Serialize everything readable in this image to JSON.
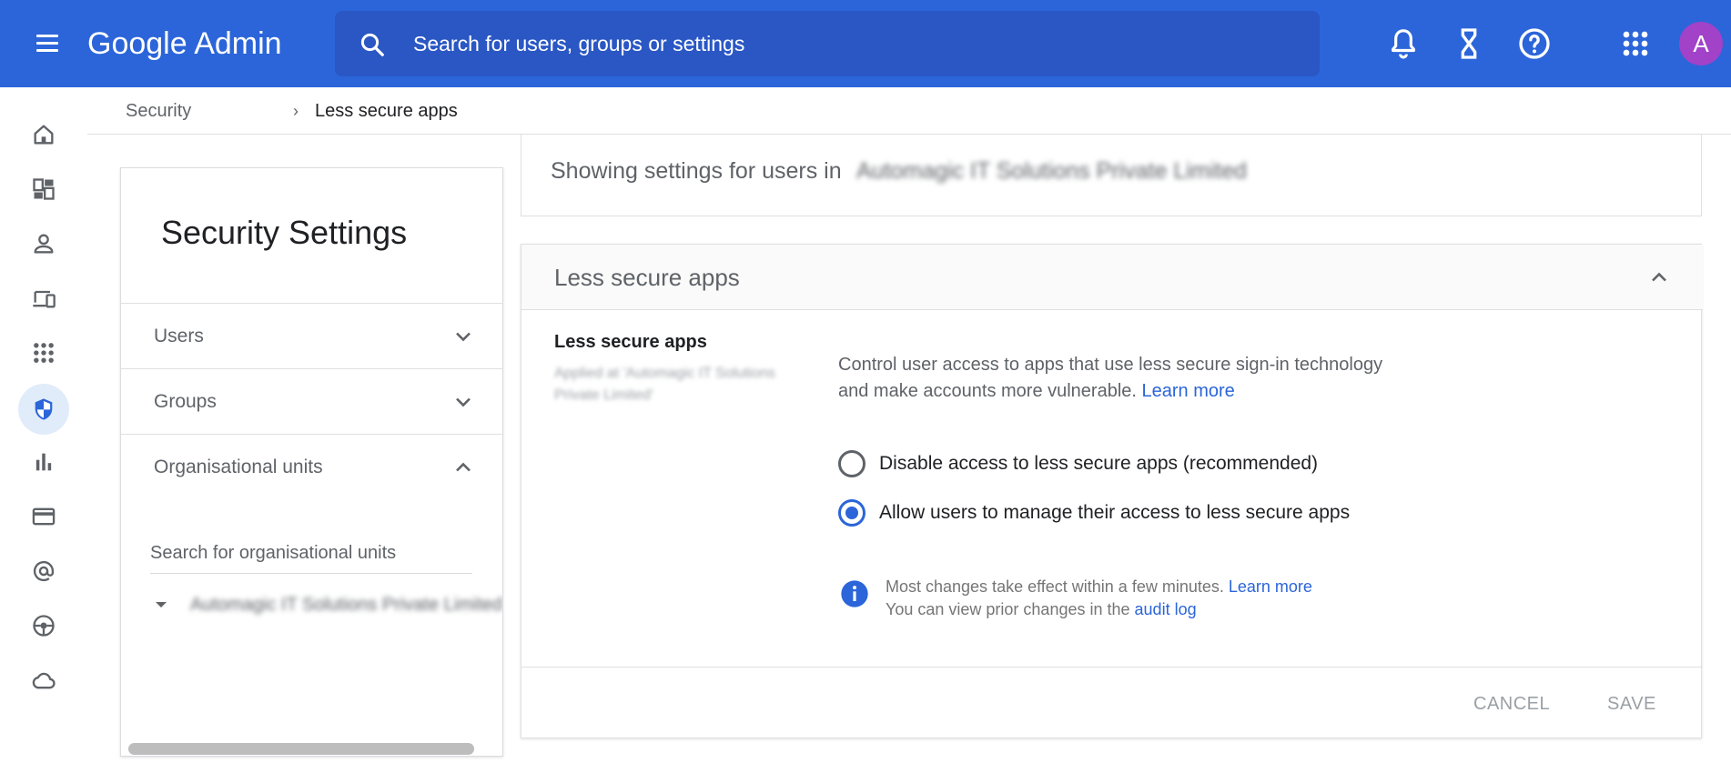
{
  "app": {
    "title": "Google Admin",
    "search_placeholder": "Search for users, groups or settings",
    "avatar_initial": "A",
    "accent_color": "#2b65d9"
  },
  "top_icons": [
    "notifications-icon",
    "tasks-hourglass-icon",
    "help-icon",
    "apps-grid-icon"
  ],
  "rail": {
    "items": [
      "home-icon",
      "dashboard-icon",
      "user-icon",
      "devices-icon",
      "apps-icon",
      "security-shield-icon",
      "reports-icon",
      "billing-icon",
      "account-at-icon",
      "rules-icon",
      "cloud-icon"
    ],
    "active": "security-shield-icon"
  },
  "breadcrumb": {
    "parent": "Security",
    "separator": "›",
    "current": "Less secure apps"
  },
  "left_panel": {
    "title": "Security Settings",
    "rows": [
      {
        "label": "Users",
        "expanded": false
      },
      {
        "label": "Groups",
        "expanded": false
      },
      {
        "label": "Organisational units",
        "expanded": true
      }
    ],
    "ou_search_placeholder": "Search for organisational units",
    "ou_root": "Automagic IT Solutions Private Limited"
  },
  "showing": {
    "prefix": "Showing settings for users in",
    "org": "Automagic IT Solutions Private Limited"
  },
  "settings_card": {
    "header_title": "Less secure apps",
    "setting_name": "Less secure apps",
    "applied_at": "Applied at 'Automagic IT Solutions Private Limited'",
    "description": "Control user access to apps that use less secure sign-in technology and make accounts more vulnerable.",
    "description_link": "Learn more",
    "options": [
      {
        "label": "Disable access to less secure apps (recommended)",
        "selected": false
      },
      {
        "label": "Allow users to manage their access to less secure apps",
        "selected": true
      }
    ],
    "info_line1": "Most changes take effect within a few minutes.",
    "info_line1_link": "Learn more",
    "info_line2": "You can view prior changes in the",
    "info_line2_link": "audit log",
    "cancel_label": "CANCEL",
    "save_label": "SAVE"
  }
}
